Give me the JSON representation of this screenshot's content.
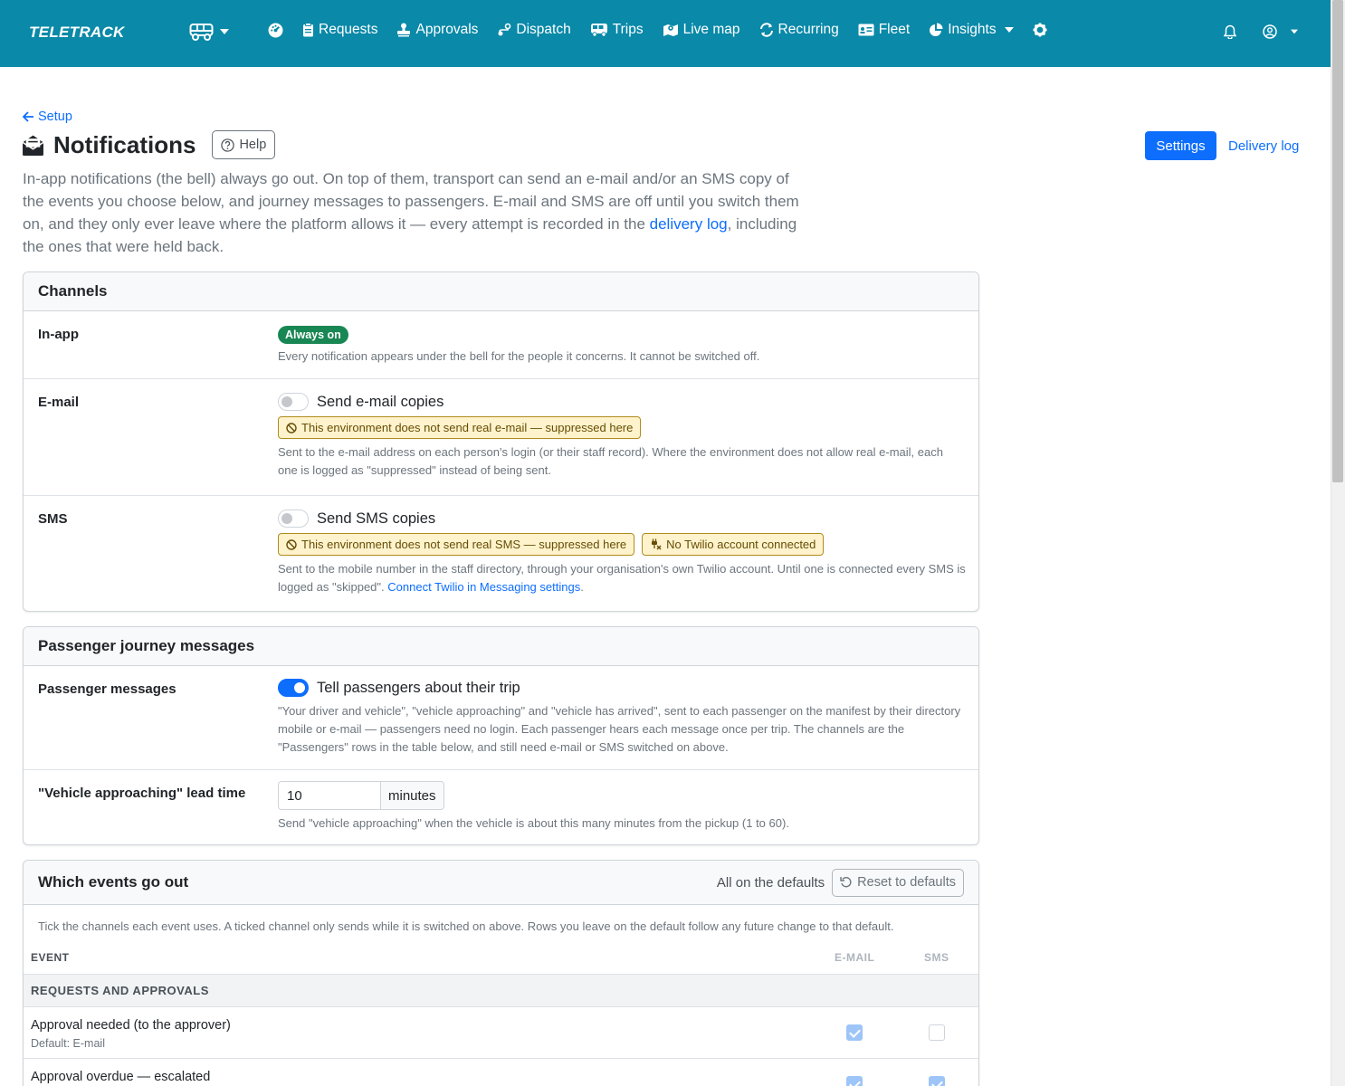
{
  "nav": {
    "brand": "TELETRACK",
    "items": [
      {
        "id": "requests",
        "label": "Requests",
        "icon": "clipboard-icon"
      },
      {
        "id": "approvals",
        "label": "Approvals",
        "icon": "stamp-icon"
      },
      {
        "id": "dispatch",
        "label": "Dispatch",
        "icon": "route-icon"
      },
      {
        "id": "trips",
        "label": "Trips",
        "icon": "bus-icon"
      },
      {
        "id": "livemap",
        "label": "Live map",
        "icon": "map-icon"
      },
      {
        "id": "recurring",
        "label": "Recurring",
        "icon": "repeat-icon"
      },
      {
        "id": "fleet",
        "label": "Fleet",
        "icon": "id-card-icon"
      },
      {
        "id": "insights",
        "label": "Insights",
        "icon": "pie-chart-icon"
      }
    ],
    "colors": {
      "bar": "#0a89a8"
    }
  },
  "page": {
    "back_label": "Setup",
    "title": "Notifications",
    "help_label": "Help",
    "tabs": {
      "settings": "Settings",
      "delivery_log": "Delivery log"
    },
    "lead_part1": "In-app notifications (the bell) always go out. On top of them, transport can send an e-mail and/or an SMS copy of the events you choose below, and journey messages to passengers. E-mail and SMS are off until you switch them on, and they only ever leave where the platform allows it — every attempt is recorded in the ",
    "lead_link": "delivery log",
    "lead_part2": ", including the ones that were held back."
  },
  "channels": {
    "header": "Channels",
    "inapp": {
      "label": "In-app",
      "badge": "Always on",
      "desc": "Every notification appears under the bell for the people it concerns. It cannot be switched off."
    },
    "email": {
      "label": "E-mail",
      "switch_label": "Send e-mail copies",
      "enabled": false,
      "warning": "This environment does not send real e-mail — suppressed here",
      "desc": "Sent to the e-mail address on each person's login (or their staff record). Where the environment does not allow real e-mail, each one is logged as \"suppressed\" instead of being sent."
    },
    "sms": {
      "label": "SMS",
      "switch_label": "Send SMS copies",
      "enabled": false,
      "warning": "This environment does not send real SMS — suppressed here",
      "warning2": "No Twilio account connected",
      "desc": "Sent to the mobile number in the staff directory, through your organisation's own Twilio account. Until one is connected every SMS is logged as \"skipped\". ",
      "desc_link": "Connect Twilio in Messaging settings",
      "desc_end": "."
    }
  },
  "passenger": {
    "header": "Passenger journey messages",
    "messages": {
      "label": "Passenger messages",
      "switch_label": "Tell passengers about their trip",
      "enabled": true,
      "desc": "\"Your driver and vehicle\", \"vehicle approaching\" and \"vehicle has arrived\", sent to each passenger on the manifest by their directory mobile or e-mail — passengers need no login. Each passenger hears each message once per trip. The channels are the \"Passengers\" rows in the table below, and still need e-mail or SMS switched on above."
    },
    "lead_time": {
      "label": "\"Vehicle approaching\" lead time",
      "value": "10",
      "unit": "minutes",
      "desc": "Send \"vehicle approaching\" when the vehicle is about this many minutes from the pickup (1 to 60)."
    }
  },
  "events": {
    "header": "Which events go out",
    "status": "All on the defaults",
    "reset_label": "Reset to defaults",
    "intro": "Tick the channels each event uses. A ticked channel only sends while it is switched on above. Rows you leave on the default follow any future change to that default.",
    "columns": {
      "event": "EVENT",
      "email": "E-MAIL",
      "sms": "SMS"
    },
    "groups": [
      {
        "title": "REQUESTS AND APPROVALS",
        "rows": [
          {
            "name": "Approval needed (to the approver)",
            "default": "Default: E-mail",
            "email": true,
            "sms": false
          },
          {
            "name": "Approval overdue — escalated",
            "default": "",
            "email": true,
            "sms": true
          }
        ]
      }
    ]
  }
}
